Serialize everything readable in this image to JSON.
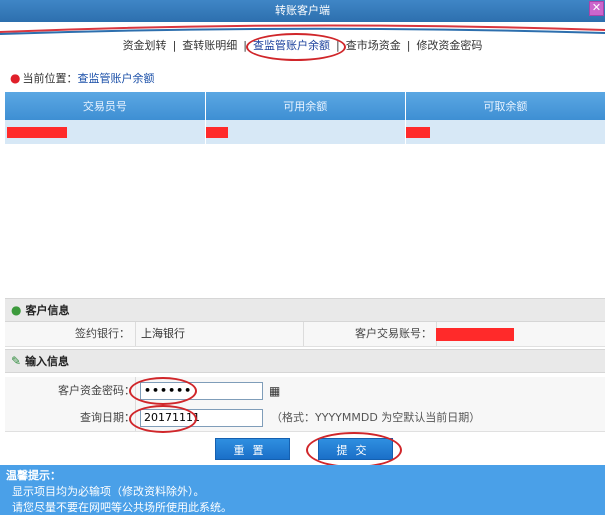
{
  "window": {
    "title": "转账客户端",
    "close_glyph": "✕"
  },
  "nav": {
    "items": [
      "资金划转",
      "查转账明细",
      "查监管账户余额",
      "查市场资金",
      "修改资金密码"
    ],
    "separator": "|"
  },
  "location": {
    "label": "当前位置：",
    "link": "查监管账户余额"
  },
  "balance_table": {
    "headers": [
      "交易员号",
      "可用余额",
      "可取余额"
    ]
  },
  "customer_info": {
    "section_title": "客户信息",
    "bank_label": "签约银行：",
    "bank_value": "上海银行",
    "account_label": "客户交易账号："
  },
  "input_info": {
    "section_title": "输入信息",
    "password_label": "客户资金密码：",
    "password_value": "••••••",
    "date_label": "查询日期：",
    "date_value": "20171111",
    "date_hint": "（格式：YYYYMMDD 为空默认当前日期）"
  },
  "buttons": {
    "reset": "重置",
    "submit": "提交"
  },
  "tips": {
    "title": "温馨提示：",
    "line1": "显示项目均为必输项（修改资料除外）。",
    "line2": "请您尽量不要在网吧等公共场所使用此系统。"
  },
  "colors": {
    "header_blue": "#3f86c6",
    "redaction": "#ff2a2a",
    "annotation": "#d0262a"
  }
}
